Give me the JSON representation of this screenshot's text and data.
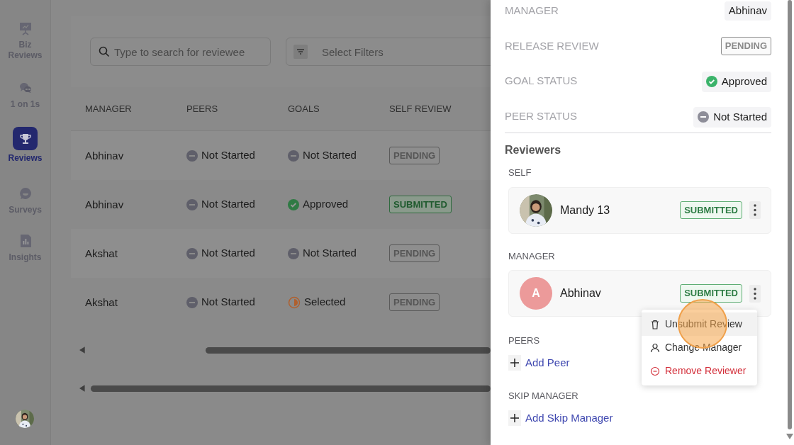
{
  "sidebar": {
    "items": [
      {
        "label": "Biz Reviews",
        "selected": false
      },
      {
        "label": "1 on 1s",
        "selected": false
      },
      {
        "label": "Reviews",
        "selected": true
      },
      {
        "label": "Surveys",
        "selected": false
      },
      {
        "label": "Insights",
        "selected": false
      }
    ]
  },
  "search": {
    "placeholder": "Type to search for reviewee"
  },
  "filters": {
    "placeholder": "Select Filters"
  },
  "table": {
    "columns": [
      "MANAGER",
      "PEERS",
      "GOALS",
      "SELF REVIEW"
    ],
    "rows": [
      {
        "manager": "Abhinav",
        "peers": {
          "kind": "not_started",
          "label": "Not Started"
        },
        "goals": {
          "kind": "not_started",
          "label": "Not Started"
        },
        "self_review": {
          "kind": "pending",
          "label": "PENDING"
        }
      },
      {
        "manager": "Abhinav",
        "peers": {
          "kind": "not_started",
          "label": "Not Started"
        },
        "goals": {
          "kind": "approved",
          "label": "Approved"
        },
        "self_review": {
          "kind": "submitted",
          "label": "SUBMITTED"
        }
      },
      {
        "manager": "Akshat",
        "peers": {
          "kind": "not_started",
          "label": "Not Started"
        },
        "goals": {
          "kind": "not_started",
          "label": "Not Started"
        },
        "self_review": {
          "kind": "pending",
          "label": "PENDING"
        }
      },
      {
        "manager": "Akshat",
        "peers": {
          "kind": "not_started",
          "label": "Not Started"
        },
        "goals": {
          "kind": "selected",
          "label": "Selected"
        },
        "self_review": {
          "kind": "pending",
          "label": "PENDING"
        }
      }
    ]
  },
  "panel": {
    "fields": [
      {
        "label": "MANAGER",
        "kind": "text",
        "value": "Abhinav"
      },
      {
        "label": "RELEASE REVIEW",
        "kind": "pending",
        "value": "PENDING"
      },
      {
        "label": "GOAL STATUS",
        "kind": "approved",
        "value": "Approved"
      },
      {
        "label": "PEER STATUS",
        "kind": "not_started",
        "value": "Not Started"
      }
    ],
    "reviewers_title": "Reviewers",
    "sections": [
      {
        "title": "SELF",
        "reviewers": [
          {
            "name": "Mandy 13",
            "badge": "SUBMITTED"
          }
        ]
      },
      {
        "title": "MANAGER",
        "reviewers": [
          {
            "name": "Abhinav",
            "kind": "initial",
            "initial": "A",
            "badge": "SUBMITTED"
          }
        ]
      },
      {
        "title": "PEERS",
        "add": "Add Peer"
      },
      {
        "title": "SKIP MANAGER",
        "add": "Add Skip Manager"
      }
    ]
  },
  "menu": {
    "items": [
      {
        "label": "Unsubmit Review",
        "kind": "normal",
        "selected": true
      },
      {
        "label": "Change Manager",
        "kind": "normal",
        "selected": false
      },
      {
        "label": "Remove Reviewer",
        "kind": "danger",
        "selected": false
      }
    ]
  }
}
